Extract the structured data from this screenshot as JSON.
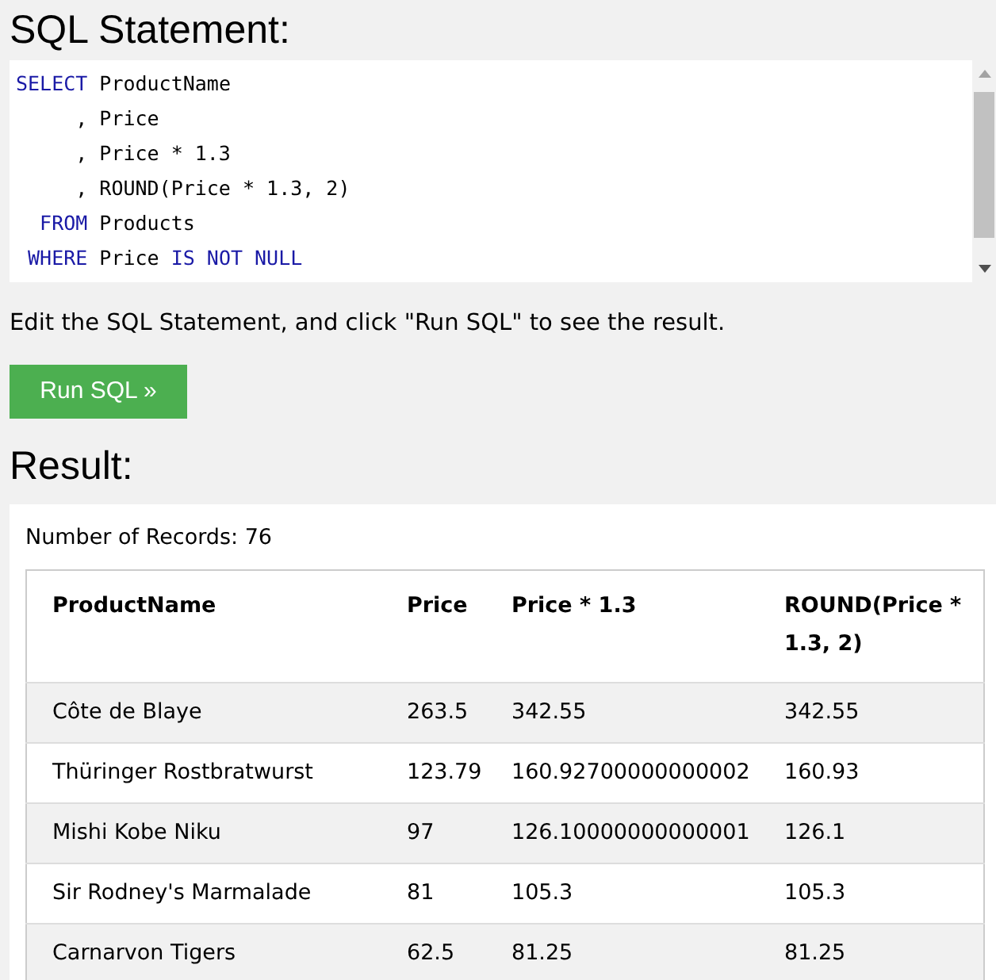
{
  "sql_heading": "SQL Statement:",
  "code_lines": [
    {
      "tokens": [
        {
          "text": "SELECT",
          "kind": "keyword"
        },
        {
          "text": " ProductName",
          "kind": "plain"
        }
      ]
    },
    {
      "tokens": [
        {
          "text": "     , Price",
          "kind": "plain"
        }
      ]
    },
    {
      "tokens": [
        {
          "text": "     , Price * 1.3",
          "kind": "plain"
        }
      ]
    },
    {
      "tokens": [
        {
          "text": "     , ROUND(Price * 1.3, 2)",
          "kind": "plain"
        }
      ]
    },
    {
      "tokens": [
        {
          "text": "  FROM",
          "kind": "keyword"
        },
        {
          "text": " Products",
          "kind": "plain"
        }
      ]
    },
    {
      "tokens": [
        {
          "text": " WHERE",
          "kind": "keyword"
        },
        {
          "text": " Price ",
          "kind": "plain"
        },
        {
          "text": "IS NOT NULL",
          "kind": "keyword"
        }
      ]
    }
  ],
  "instruction": "Edit the SQL Statement, and click \"Run SQL\" to see the result.",
  "run_button": "Run SQL »",
  "result_heading": "Result:",
  "record_count": "Number of Records: 76",
  "table": {
    "columns": [
      "ProductName",
      "Price",
      "Price * 1.3",
      "ROUND(Price * 1.3, 2)"
    ],
    "rows": [
      [
        "Côte de Blaye",
        "263.5",
        "342.55",
        "342.55"
      ],
      [
        "Thüringer Rostbratwurst",
        "123.79",
        "160.92700000000002",
        "160.93"
      ],
      [
        "Mishi Kobe Niku",
        "97",
        "126.10000000000001",
        "126.1"
      ],
      [
        "Sir Rodney's Marmalade",
        "81",
        "105.3",
        "105.3"
      ],
      [
        "Carnarvon Tigers",
        "62.5",
        "81.25",
        "81.25"
      ]
    ]
  }
}
